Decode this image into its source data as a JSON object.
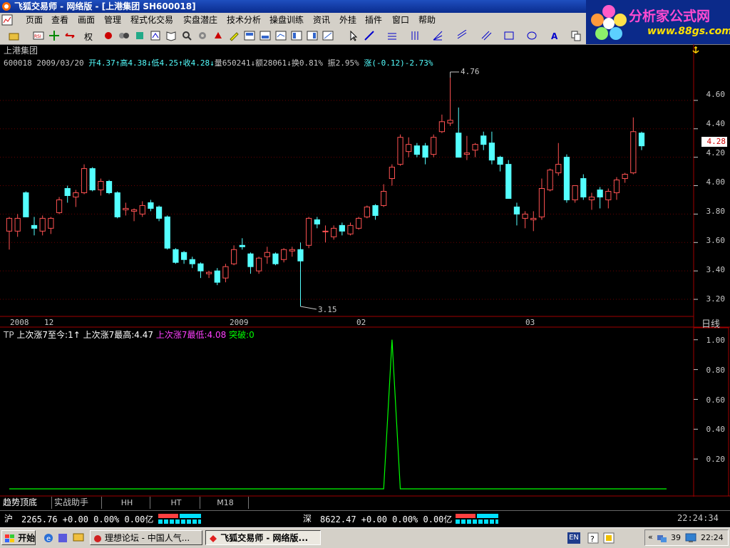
{
  "window": {
    "title": "飞狐交易师 - 网络版 - [上港集团 SH600018]"
  },
  "menu": [
    "页面",
    "查看",
    "画面",
    "管理",
    "程式化交易",
    "实盘潜庄",
    "技术分析",
    "操盘训练",
    "资讯",
    "外挂",
    "插件",
    "窗口",
    "帮助"
  ],
  "toolbar": {
    "quan_label": "权"
  },
  "logo": {
    "line1": "分析家公式网",
    "line2": "www.88gs.com"
  },
  "stock": {
    "name": "上港集团",
    "code": "600018",
    "date": "2009/03/20",
    "open": "开4.37↑",
    "high": "高4.38↓",
    "low": "低4.25↑",
    "close": "收4.28↓",
    "volume": "量650241↓",
    "amount": "额28061↓",
    "turnover": "换0.81%",
    "amplitude": "振2.95%",
    "change": "涨(-0.12)-2.73%",
    "current_price": "4.28",
    "max_label": "4.76",
    "min_label": "3.15"
  },
  "chart_data": [
    {
      "type": "candlestick",
      "title": "上港集团",
      "period": "日线",
      "x_labels": [
        "2008",
        "12",
        "2009",
        "02",
        "03"
      ],
      "y_ticks": [
        "4.60",
        "4.40",
        "4.20",
        "4.00",
        "3.80",
        "3.60",
        "3.40",
        "3.20"
      ],
      "ylim": [
        3.1,
        4.85
      ],
      "candles": [
        {
          "o": 3.68,
          "h": 3.78,
          "l": 3.55,
          "c": 3.77
        },
        {
          "o": 3.68,
          "h": 3.8,
          "l": 3.64,
          "c": 3.77
        },
        {
          "o": 3.95,
          "h": 3.96,
          "l": 3.78,
          "c": 3.78
        },
        {
          "o": 3.72,
          "h": 3.78,
          "l": 3.65,
          "c": 3.7
        },
        {
          "o": 3.68,
          "h": 3.79,
          "l": 3.65,
          "c": 3.77
        },
        {
          "o": 3.7,
          "h": 3.78,
          "l": 3.66,
          "c": 3.77
        },
        {
          "o": 3.81,
          "h": 3.92,
          "l": 3.8,
          "c": 3.9
        },
        {
          "o": 3.98,
          "h": 4.0,
          "l": 3.88,
          "c": 3.93
        },
        {
          "o": 3.92,
          "h": 3.97,
          "l": 3.85,
          "c": 3.95
        },
        {
          "o": 3.95,
          "h": 4.15,
          "l": 3.94,
          "c": 4.12
        },
        {
          "o": 4.12,
          "h": 4.13,
          "l": 3.96,
          "c": 3.97
        },
        {
          "o": 3.97,
          "h": 4.05,
          "l": 3.93,
          "c": 4.03
        },
        {
          "o": 4.03,
          "h": 4.04,
          "l": 3.94,
          "c": 3.95
        },
        {
          "o": 3.95,
          "h": 3.96,
          "l": 3.77,
          "c": 3.78
        },
        {
          "o": 3.83,
          "h": 3.88,
          "l": 3.79,
          "c": 3.84
        },
        {
          "o": 3.82,
          "h": 3.84,
          "l": 3.75,
          "c": 3.83
        },
        {
          "o": 3.8,
          "h": 3.89,
          "l": 3.78,
          "c": 3.86
        },
        {
          "o": 3.88,
          "h": 3.9,
          "l": 3.82,
          "c": 3.84
        },
        {
          "o": 3.85,
          "h": 3.86,
          "l": 3.75,
          "c": 3.77
        },
        {
          "o": 3.78,
          "h": 3.79,
          "l": 3.55,
          "c": 3.56
        },
        {
          "o": 3.55,
          "h": 3.56,
          "l": 3.45,
          "c": 3.46
        },
        {
          "o": 3.53,
          "h": 3.54,
          "l": 3.45,
          "c": 3.48
        },
        {
          "o": 3.48,
          "h": 3.5,
          "l": 3.42,
          "c": 3.45
        },
        {
          "o": 3.45,
          "h": 3.46,
          "l": 3.35,
          "c": 3.4
        },
        {
          "o": 3.38,
          "h": 3.4,
          "l": 3.35,
          "c": 3.39
        },
        {
          "o": 3.4,
          "h": 3.42,
          "l": 3.3,
          "c": 3.32
        },
        {
          "o": 3.35,
          "h": 3.45,
          "l": 3.32,
          "c": 3.43
        },
        {
          "o": 3.45,
          "h": 3.58,
          "l": 3.44,
          "c": 3.55
        },
        {
          "o": 3.58,
          "h": 3.63,
          "l": 3.55,
          "c": 3.57
        },
        {
          "o": 3.52,
          "h": 3.53,
          "l": 3.38,
          "c": 3.43
        },
        {
          "o": 3.4,
          "h": 3.5,
          "l": 3.38,
          "c": 3.49
        },
        {
          "o": 3.5,
          "h": 3.57,
          "l": 3.45,
          "c": 3.53
        },
        {
          "o": 3.52,
          "h": 3.53,
          "l": 3.44,
          "c": 3.45
        },
        {
          "o": 3.48,
          "h": 3.56,
          "l": 3.46,
          "c": 3.55
        },
        {
          "o": 3.54,
          "h": 3.57,
          "l": 3.5,
          "c": 3.55
        },
        {
          "o": 3.55,
          "h": 3.6,
          "l": 3.15,
          "c": 3.47
        },
        {
          "o": 3.58,
          "h": 3.78,
          "l": 3.56,
          "c": 3.77
        },
        {
          "o": 3.76,
          "h": 3.78,
          "l": 3.7,
          "c": 3.73
        },
        {
          "o": 3.68,
          "h": 3.72,
          "l": 3.6,
          "c": 3.68
        },
        {
          "o": 3.64,
          "h": 3.72,
          "l": 3.62,
          "c": 3.7
        },
        {
          "o": 3.72,
          "h": 3.74,
          "l": 3.65,
          "c": 3.68
        },
        {
          "o": 3.66,
          "h": 3.74,
          "l": 3.65,
          "c": 3.72
        },
        {
          "o": 3.7,
          "h": 3.78,
          "l": 3.69,
          "c": 3.77
        },
        {
          "o": 3.78,
          "h": 3.86,
          "l": 3.77,
          "c": 3.85
        },
        {
          "o": 3.86,
          "h": 3.87,
          "l": 3.76,
          "c": 3.79
        },
        {
          "o": 3.86,
          "h": 4.01,
          "l": 3.85,
          "c": 3.96
        },
        {
          "o": 4.05,
          "h": 4.15,
          "l": 4.0,
          "c": 4.13
        },
        {
          "o": 4.15,
          "h": 4.36,
          "l": 4.14,
          "c": 4.34
        },
        {
          "o": 4.24,
          "h": 4.34,
          "l": 4.2,
          "c": 4.29
        },
        {
          "o": 4.28,
          "h": 4.3,
          "l": 4.2,
          "c": 4.22
        },
        {
          "o": 4.28,
          "h": 4.3,
          "l": 4.15,
          "c": 4.2
        },
        {
          "o": 4.22,
          "h": 4.36,
          "l": 4.2,
          "c": 4.34
        },
        {
          "o": 4.38,
          "h": 4.5,
          "l": 4.37,
          "c": 4.45
        },
        {
          "o": 4.44,
          "h": 4.76,
          "l": 4.42,
          "c": 4.46
        },
        {
          "o": 4.37,
          "h": 4.55,
          "l": 4.2,
          "c": 4.2
        },
        {
          "o": 4.22,
          "h": 4.35,
          "l": 4.18,
          "c": 4.23
        },
        {
          "o": 4.25,
          "h": 4.3,
          "l": 4.2,
          "c": 4.29
        },
        {
          "o": 4.35,
          "h": 4.38,
          "l": 4.25,
          "c": 4.29
        },
        {
          "o": 4.3,
          "h": 4.38,
          "l": 4.15,
          "c": 4.18
        },
        {
          "o": 4.2,
          "h": 4.21,
          "l": 4.1,
          "c": 4.15
        },
        {
          "o": 4.15,
          "h": 4.18,
          "l": 3.95,
          "c": 3.91
        },
        {
          "o": 3.85,
          "h": 3.88,
          "l": 3.72,
          "c": 3.8
        },
        {
          "o": 3.77,
          "h": 3.82,
          "l": 3.7,
          "c": 3.8
        },
        {
          "o": 3.76,
          "h": 3.82,
          "l": 3.68,
          "c": 3.77
        },
        {
          "o": 3.78,
          "h": 4.05,
          "l": 3.76,
          "c": 3.98
        },
        {
          "o": 3.97,
          "h": 4.12,
          "l": 3.96,
          "c": 4.11
        },
        {
          "o": 4.09,
          "h": 4.3,
          "l": 4.07,
          "c": 4.15
        },
        {
          "o": 4.2,
          "h": 4.22,
          "l": 3.88,
          "c": 3.9
        },
        {
          "o": 3.9,
          "h": 4.0,
          "l": 3.88,
          "c": 4.0
        },
        {
          "o": 4.05,
          "h": 4.08,
          "l": 3.9,
          "c": 3.92
        },
        {
          "o": 3.9,
          "h": 3.95,
          "l": 3.83,
          "c": 3.92
        },
        {
          "o": 3.97,
          "h": 3.99,
          "l": 3.84,
          "c": 3.92
        },
        {
          "o": 3.9,
          "h": 3.98,
          "l": 3.84,
          "c": 3.96
        },
        {
          "o": 3.95,
          "h": 4.06,
          "l": 3.9,
          "c": 4.04
        },
        {
          "o": 4.05,
          "h": 4.09,
          "l": 4.02,
          "c": 4.08
        },
        {
          "o": 4.09,
          "h": 4.48,
          "l": 4.08,
          "c": 4.38
        },
        {
          "o": 4.37,
          "h": 4.38,
          "l": 4.25,
          "c": 4.28
        }
      ]
    },
    {
      "type": "line",
      "ylim": [
        0,
        1.08
      ],
      "y_ticks": [
        "1.00",
        "0.80",
        "0.60",
        "0.40",
        "0.20"
      ],
      "indicator_labels": {
        "tp": "TP",
        "days": "上次涨7至今:1↑",
        "high": "上次涨7最高:4.47",
        "low": "上次涨7最低:4.08",
        "breakout": "突破:0"
      },
      "series": [
        {
          "values": [
            0,
            0,
            0,
            0,
            0,
            0,
            0,
            0,
            0,
            0,
            0,
            0,
            0,
            0,
            0,
            0,
            0,
            0,
            0,
            0,
            0,
            0,
            0,
            0,
            0,
            0,
            0,
            0,
            0,
            0,
            0,
            0,
            0,
            0,
            0,
            0,
            0,
            0,
            0,
            0,
            0,
            0,
            0,
            0,
            0,
            0,
            1,
            0,
            0,
            0,
            0,
            0,
            0,
            0,
            0,
            0,
            0,
            0,
            0,
            0,
            0,
            0,
            0,
            0,
            0,
            0,
            0,
            0,
            0,
            0,
            0,
            0,
            0,
            0,
            0,
            0,
            0,
            0,
            0,
            0
          ]
        }
      ]
    }
  ],
  "tabs": [
    "趋势顶底",
    "实战助手",
    "HH",
    "HT",
    "M18"
  ],
  "status": {
    "sh_label": "沪",
    "sh_text": "2265.76 +0.00 0.00% 0.00亿",
    "sz_label": "深",
    "sz_text": "8622.47 +0.00 0.00% 0.00亿",
    "time": "22:24:34"
  },
  "taskbar": {
    "start": "开始",
    "items": [
      "理想论坛 - 中国人气...",
      "飞狐交易师 - 网络版..."
    ],
    "lang": "EN",
    "tray_num": "39",
    "clock": "22:24"
  },
  "colors": {
    "up": "#ff5252",
    "down": "#54ffff",
    "bg": "#000000",
    "frame": "#a00000",
    "signal": "#00ff00"
  }
}
